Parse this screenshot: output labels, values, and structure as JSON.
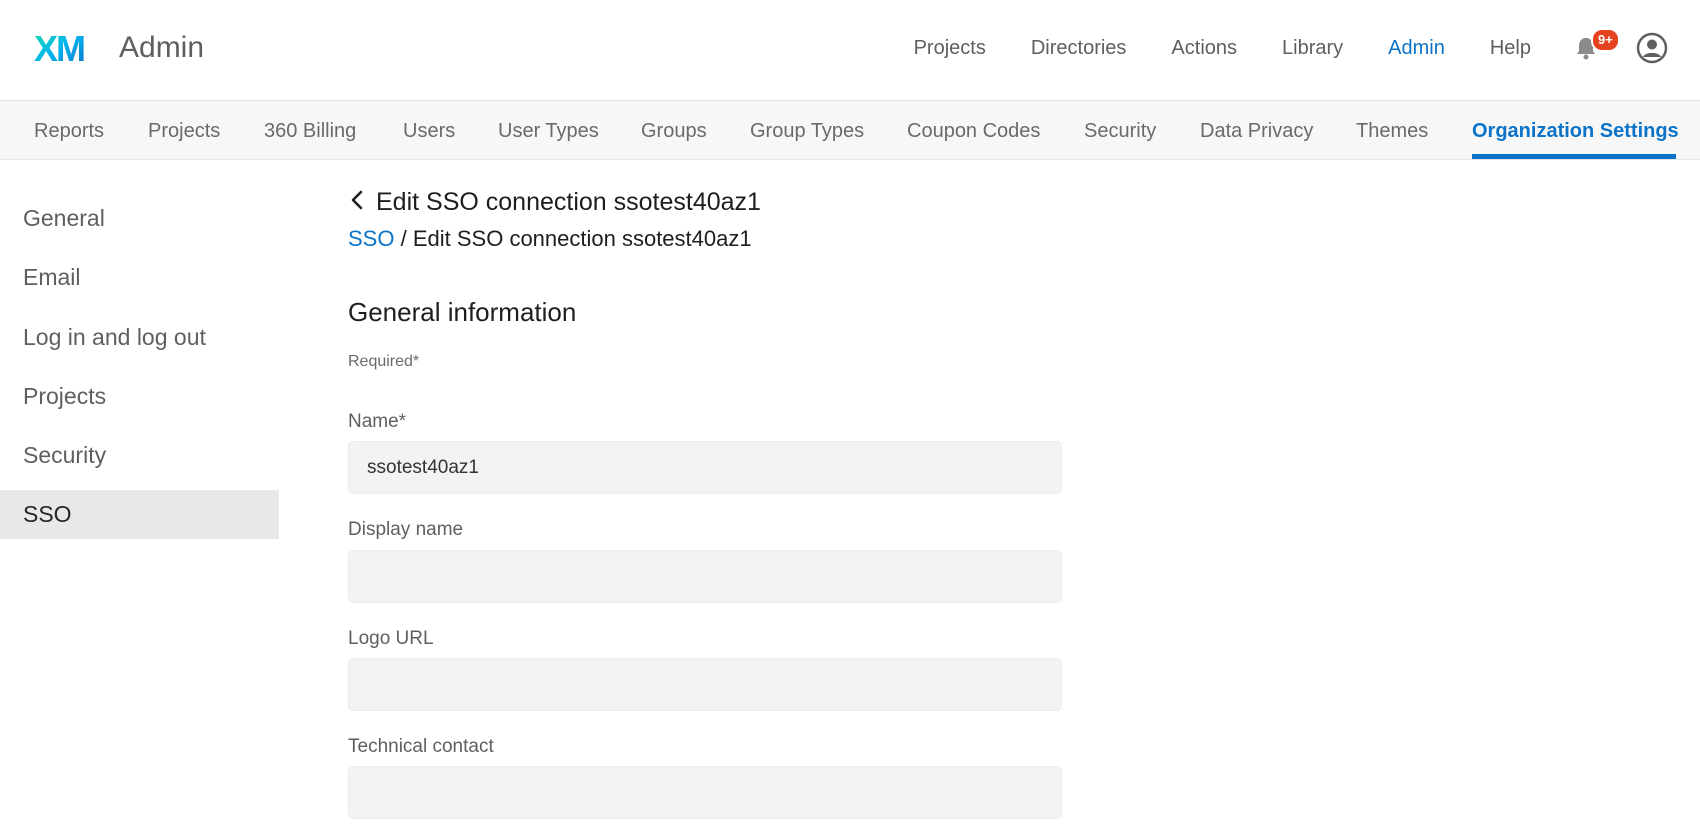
{
  "header": {
    "logo_text": "XM",
    "app_title": "Admin",
    "nav": [
      {
        "label": "Projects"
      },
      {
        "label": "Directories"
      },
      {
        "label": "Actions"
      },
      {
        "label": "Library"
      },
      {
        "label": "Admin",
        "active": true
      },
      {
        "label": "Help"
      }
    ],
    "notification_badge": "9+",
    "accent_color": "#0b74c9",
    "badge_color": "#e5421f"
  },
  "subnav": {
    "items": [
      {
        "label": "Reports"
      },
      {
        "label": "Projects"
      },
      {
        "label": "360 Billing"
      },
      {
        "label": "Users"
      },
      {
        "label": "User Types"
      },
      {
        "label": "Groups"
      },
      {
        "label": "Group Types"
      },
      {
        "label": "Coupon Codes"
      },
      {
        "label": "Security"
      },
      {
        "label": "Data Privacy"
      },
      {
        "label": "Themes"
      },
      {
        "label": "Organization Settings",
        "active": true
      }
    ]
  },
  "sidebar": {
    "items": [
      {
        "label": "General"
      },
      {
        "label": "Email"
      },
      {
        "label": "Log in and log out"
      },
      {
        "label": "Projects"
      },
      {
        "label": "Security"
      },
      {
        "label": "SSO",
        "active": true
      }
    ]
  },
  "main": {
    "page_title": "Edit SSO connection ssotest40az1",
    "breadcrumb": {
      "link": "SSO",
      "separator": "/",
      "current": "Edit SSO connection ssotest40az1"
    },
    "section_title": "General information",
    "required_note": "Required*",
    "fields": [
      {
        "label": "Name*",
        "value": "ssotest40az1"
      },
      {
        "label": "Display name",
        "value": ""
      },
      {
        "label": "Logo URL",
        "value": ""
      },
      {
        "label": "Technical contact",
        "value": ""
      }
    ]
  }
}
